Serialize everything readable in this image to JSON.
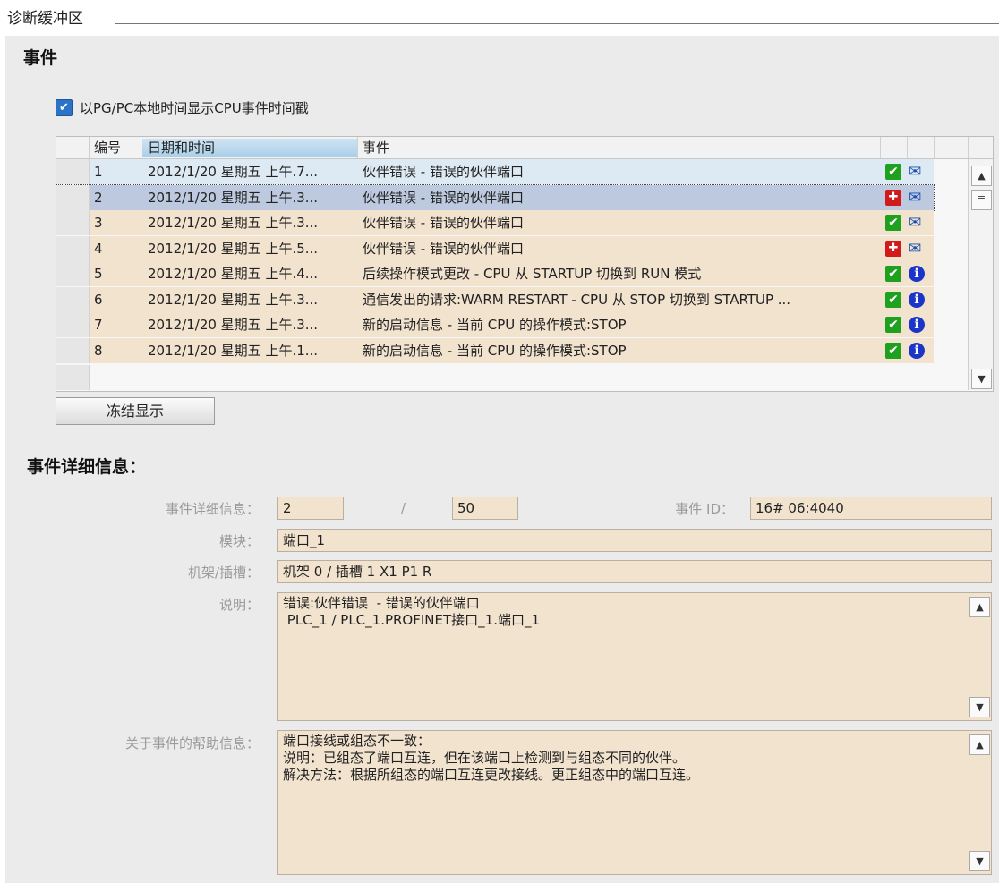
{
  "window_title": "诊断缓冲区",
  "events_section": {
    "title": "事件",
    "checkbox_label": "以PG/PC本地时间显示CPU事件时间戳",
    "checkbox_checked": true,
    "columns": {
      "number": "编号",
      "datetime": "日期和时间",
      "event": "事件"
    },
    "rows": [
      {
        "number": "1",
        "datetime": "2012/1/20 星期五 上午.7...",
        "event": "伙伴错误  - 错误的伙伴端口",
        "status_icon": "ok-icon",
        "type_icon": "outgoing-event-icon",
        "row_color": "#deeaf3"
      },
      {
        "number": "2",
        "datetime": "2012/1/20 星期五 上午.3...",
        "event": "伙伴错误  - 错误的伙伴端口",
        "status_icon": "error-icon",
        "type_icon": "incoming-event-icon",
        "row_color": "#bcc9df",
        "selected": true
      },
      {
        "number": "3",
        "datetime": "2012/1/20 星期五 上午.3...",
        "event": "伙伴错误  - 错误的伙伴端口",
        "status_icon": "ok-icon",
        "type_icon": "outgoing-event-icon",
        "row_color": "#f2e3cf"
      },
      {
        "number": "4",
        "datetime": "2012/1/20 星期五 上午.5...",
        "event": "伙伴错误  - 错误的伙伴端口",
        "status_icon": "error-icon",
        "type_icon": "incoming-event-icon",
        "row_color": "#f2e3cf"
      },
      {
        "number": "5",
        "datetime": "2012/1/20 星期五 上午.4...",
        "event": "后续操作模式更改  - CPU 从 STARTUP 切换到 RUN 模式",
        "status_icon": "ok-icon",
        "type_icon": "info-icon",
        "row_color": "#f2e3cf"
      },
      {
        "number": "6",
        "datetime": "2012/1/20 星期五 上午.3...",
        "event": "通信发出的请求:WARM RESTART  - CPU 从 STOP 切换到 STARTUP ...",
        "status_icon": "ok-icon",
        "type_icon": "info-icon",
        "row_color": "#f2e3cf"
      },
      {
        "number": "7",
        "datetime": "2012/1/20 星期五 上午.3...",
        "event": "新的启动信息 - 当前 CPU 的操作模式:STOP",
        "status_icon": "ok-icon",
        "type_icon": "info-icon",
        "row_color": "#f2e3cf"
      },
      {
        "number": "8",
        "datetime": "2012/1/20 星期五 上午.1...",
        "event": "新的启动信息 - 当前 CPU 的操作模式:STOP",
        "status_icon": "ok-icon",
        "type_icon": "info-icon",
        "row_color": "#f2e3cf"
      }
    ],
    "freeze_button": "冻结显示"
  },
  "details_section": {
    "title": "事件详细信息：",
    "labels": {
      "detail": "事件详细信息：",
      "event_id": "事件 ID：",
      "module": "模块：",
      "rack_slot": "机架/插槽：",
      "description": "说明：",
      "help": "关于事件的帮助信息："
    },
    "event_index": "2",
    "separator": "/",
    "event_total": "50",
    "event_id": "16# 06:4040",
    "module": "端口_1",
    "rack_slot": "机架 0 / 插槽 1 X1 P1 R",
    "description": "错误:伙伴错误  - 错误的伙伴端口\n PLC_1 / PLC_1.PROFINET接口_1.端口_1",
    "help": "端口接线或组态不一致：\n说明：已组态了端口互连，但在该端口上检测到与组态不同的伙伴。\n解决方法：根据所组态的端口互连更改接线。更正组态中的端口互连。"
  }
}
